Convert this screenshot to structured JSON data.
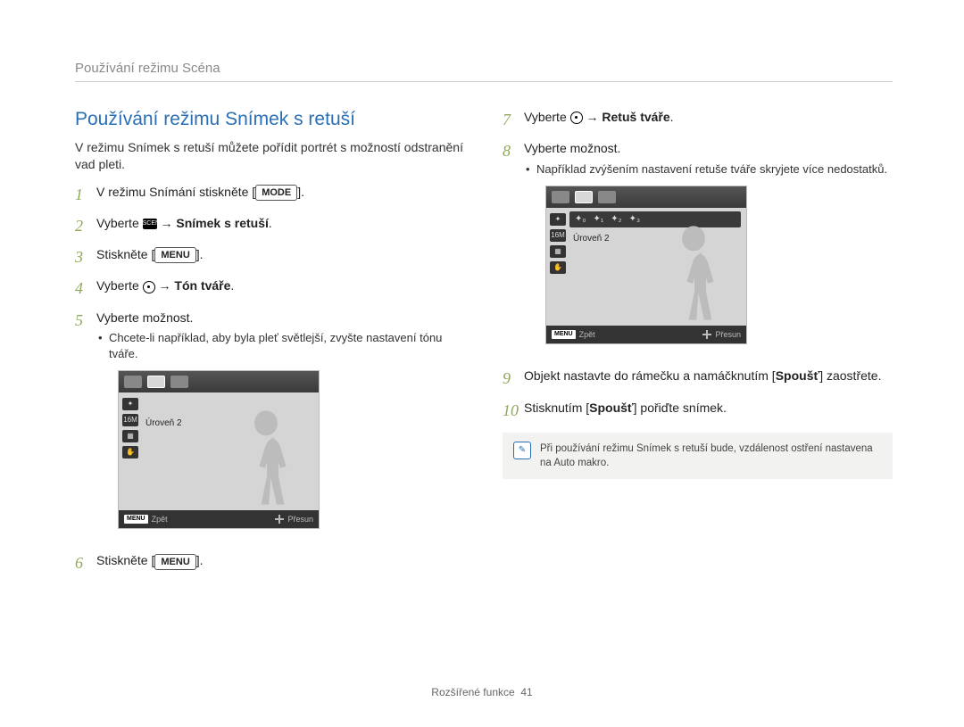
{
  "header": "Používání režimu Scéna",
  "section_title": "Používání režimu Snímek s retuší",
  "intro": "V režimu Snímek s retuší můžete pořídit portrét s možností odstranění vad pleti.",
  "left": {
    "step1_pre": "V režimu Snímání stiskněte [",
    "step1_btn": "MODE",
    "step1_post": "].",
    "step2_pre": "Vyberte ",
    "step2_arrow": " → ",
    "step2_bold": "Snímek s retuší",
    "step2_post": ".",
    "step3_pre": "Stiskněte [",
    "step3_btn": "MENU",
    "step3_post": "].",
    "step4_pre": "Vyberte ",
    "step4_arrow": " → ",
    "step4_bold": "Tón tváře",
    "step4_post": ".",
    "step5": "Vyberte možnost.",
    "step5_sub": "Chcete-li například, aby byla pleť světlejší, zvyšte nastavení tónu tváře.",
    "step6_pre": "Stiskněte [",
    "step6_btn": "MENU",
    "step6_post": "]."
  },
  "right": {
    "step7_pre": "Vyberte ",
    "step7_arrow": " → ",
    "step7_bold": "Retuš tváře",
    "step7_post": ".",
    "step8": "Vyberte možnost.",
    "step8_sub": "Například zvýšením nastavení retuše tváře skryjete více nedostatků.",
    "step9_pre": "Objekt nastavte do rámečku a namáčknutím [",
    "step9_bold": "Spoušť",
    "step9_post": "] zaostřete.",
    "step10_pre": "Stisknutím [",
    "step10_bold": "Spoušť",
    "step10_post": "] pořiďte snímek."
  },
  "screen": {
    "level": "Úroveň 2",
    "back_tag": "MENU",
    "back_label": "Zpět",
    "move_label": "Přesun"
  },
  "note": "Při používání režimu Snímek s retuší bude, vzdálenost ostření nastavena na Auto makro.",
  "footer_text": "Rozšířené funkce",
  "footer_page": "41"
}
